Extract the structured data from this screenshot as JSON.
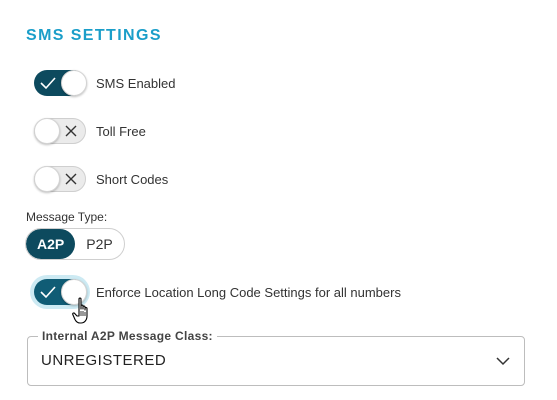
{
  "section": {
    "title": "SMS SETTINGS"
  },
  "toggles": [
    {
      "label": "SMS Enabled",
      "state": "on"
    },
    {
      "label": "Toll Free",
      "state": "off"
    },
    {
      "label": "Short Codes",
      "state": "off"
    }
  ],
  "message_type": {
    "label": "Message Type:",
    "options": [
      "A2P",
      "P2P"
    ],
    "selected": "A2P"
  },
  "enforce_toggle": {
    "label": "Enforce Location Long Code Settings for all numbers",
    "state": "on"
  },
  "a2p_class": {
    "legend": "Internal A2P Message Class:",
    "value": "UNREGISTERED",
    "icon": "chevron-down-icon"
  },
  "colors": {
    "accent": "#1a9ec9",
    "toggle_on": "#0d4a5e"
  }
}
